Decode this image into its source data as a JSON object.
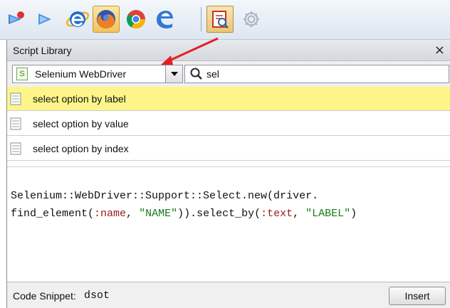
{
  "toolbar": {
    "buttons": [
      {
        "name": "record-arrow-icon"
      },
      {
        "name": "play-icon"
      },
      {
        "name": "ie-browser-icon"
      },
      {
        "name": "firefox-browser-icon",
        "active": true
      },
      {
        "name": "chrome-browser-icon"
      },
      {
        "name": "edge-browser-icon"
      },
      {
        "name": "script-library-icon",
        "active": true
      },
      {
        "name": "gear-icon"
      }
    ]
  },
  "panel": {
    "title": "Script Library",
    "close_label": "×"
  },
  "language_select": {
    "value": "Selenium WebDriver",
    "icon_letter": "S"
  },
  "search": {
    "value": "sel"
  },
  "results": [
    {
      "label": "select option by label",
      "selected": true
    },
    {
      "label": "select option by value",
      "selected": false
    },
    {
      "label": "select option by index",
      "selected": false
    }
  ],
  "code": {
    "line1": "Selenium::WebDriver::Support::Select.new(driver.",
    "line2_a": "find_element(",
    "line2_b": ":name",
    "line2_c": ", ",
    "line2_d": "\"NAME\"",
    "line2_e": ")).select_by(",
    "line2_f": ":text",
    "line2_g": ", ",
    "line2_h": "\"LABEL\"",
    "line2_i": ")"
  },
  "footer": {
    "snippet_label": "Code Snippet:",
    "snippet_value": "dsot",
    "insert_label": "Insert"
  },
  "colors": {
    "selected_row": "#fdf58a",
    "annotation_arrow": "#e32020",
    "symbol": "#9a1a1a",
    "string": "#1b7b1b"
  }
}
